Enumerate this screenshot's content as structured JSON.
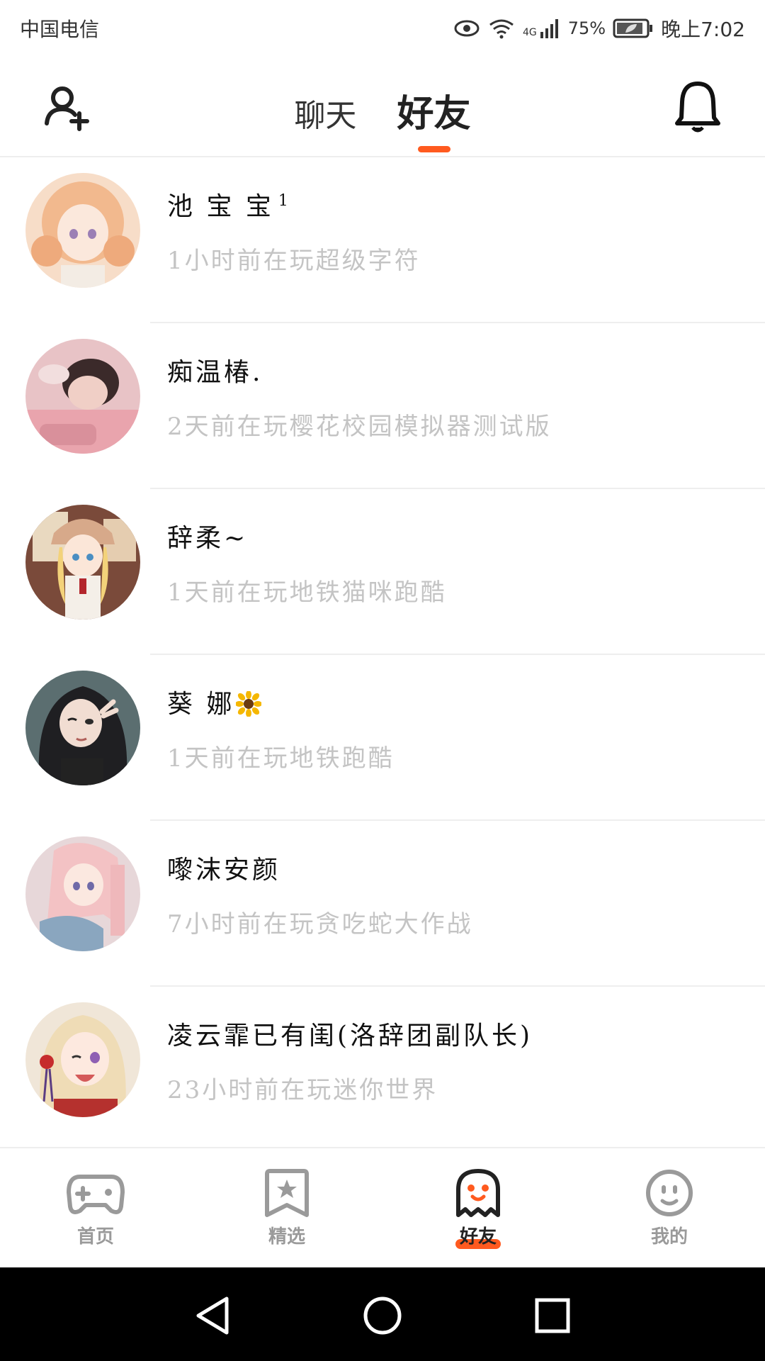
{
  "status_bar": {
    "carrier": "中国电信",
    "network": "4G",
    "battery": "75%",
    "time": "晚上7:02"
  },
  "header": {
    "tabs": [
      {
        "label": "聊天",
        "active": false
      },
      {
        "label": "好友",
        "active": true
      }
    ],
    "add_icon": "add-friend-icon",
    "bell_icon": "bell-icon",
    "accent_color": "#ff5a1f"
  },
  "friends": [
    {
      "name": "池 宝 宝",
      "badge": "1",
      "status": "1小时前在玩超级字符"
    },
    {
      "name": "痴温椿.",
      "status": "2天前在玩樱花校园模拟器测试版"
    },
    {
      "name": "辞柔~",
      "status": "1天前在玩地铁猫咪跑酷"
    },
    {
      "name": "葵 娜",
      "emoji": "sunflower",
      "status": "1天前在玩地铁跑酷"
    },
    {
      "name": "嚟沫安颜",
      "status": "7小时前在玩贪吃蛇大作战"
    },
    {
      "name": "凌云霏已有闺(洛辞团副队长)",
      "status": "23小时前在玩迷你世界"
    }
  ],
  "bottom_nav": [
    {
      "label": "首页",
      "icon": "gamepad-icon",
      "active": false
    },
    {
      "label": "精选",
      "icon": "star-bookmark-icon",
      "active": false
    },
    {
      "label": "好友",
      "icon": "ghost-icon",
      "active": true
    },
    {
      "label": "我的",
      "icon": "smiley-icon",
      "active": false
    }
  ]
}
